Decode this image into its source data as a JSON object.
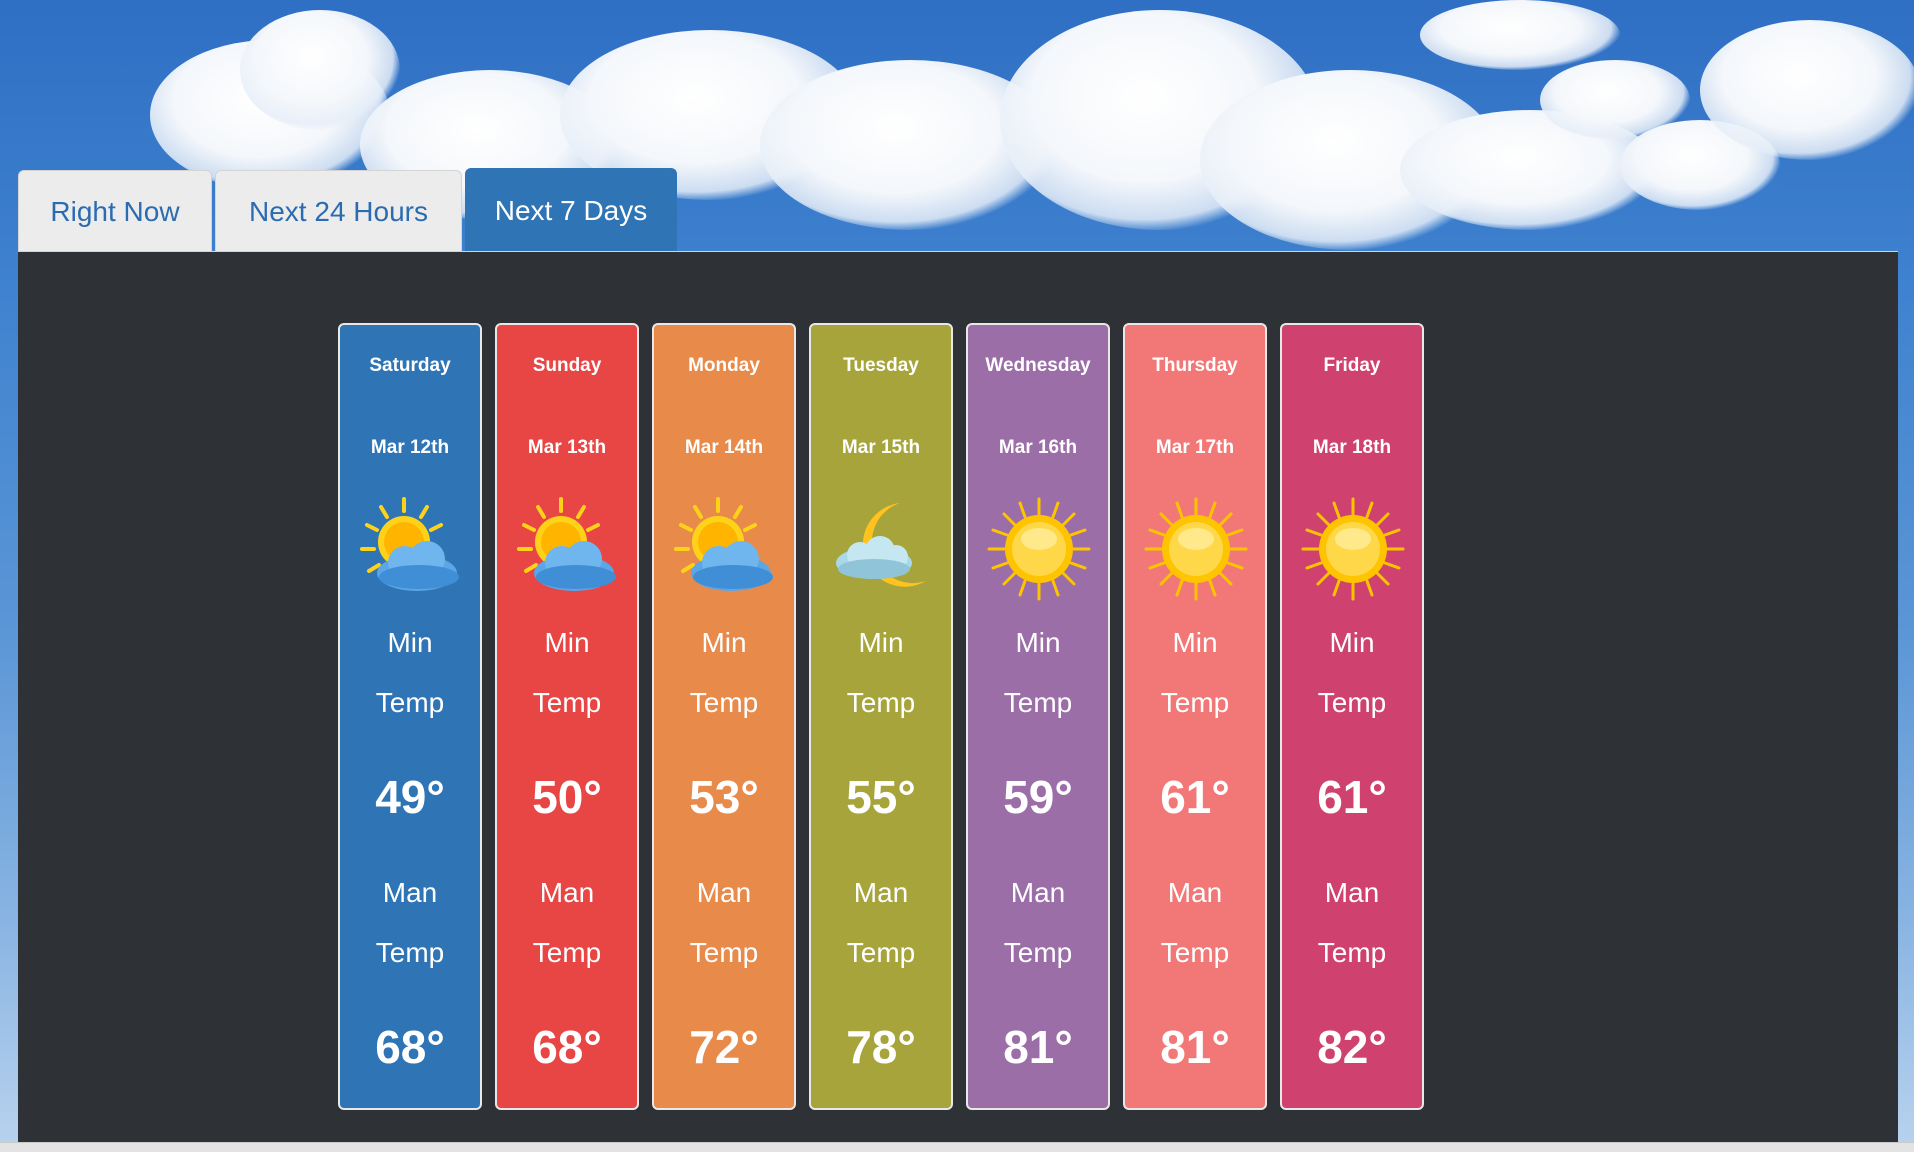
{
  "tabs": [
    {
      "label": "Right Now",
      "active": false
    },
    {
      "label": "Next 24 Hours",
      "active": false
    },
    {
      "label": "Next 7 Days",
      "active": true
    }
  ],
  "colors": {
    "tab_active": "#2f74b5",
    "tab_text": "#2b6cb0",
    "panel_bg": "#2e3135"
  },
  "days": [
    {
      "day": "Saturday",
      "date": "Mar 12th",
      "icon": "partly-cloudy-day-icon",
      "min_label_1": "Min",
      "min_label_2": "Temp",
      "min_temp": "49°",
      "max_label_1": "Man",
      "max_label_2": "Temp",
      "max_temp": "68°",
      "color": "#2f75b6"
    },
    {
      "day": "Sunday",
      "date": "Mar 13th",
      "icon": "partly-cloudy-day-icon",
      "min_label_1": "Min",
      "min_label_2": "Temp",
      "min_temp": "50°",
      "max_label_1": "Man",
      "max_label_2": "Temp",
      "max_temp": "68°",
      "color": "#e84545"
    },
    {
      "day": "Monday",
      "date": "Mar 14th",
      "icon": "partly-cloudy-day-icon",
      "min_label_1": "Min",
      "min_label_2": "Temp",
      "min_temp": "53°",
      "max_label_1": "Man",
      "max_label_2": "Temp",
      "max_temp": "72°",
      "color": "#e88a4a"
    },
    {
      "day": "Tuesday",
      "date": "Mar 15th",
      "icon": "cloudy-night-icon",
      "min_label_1": "Min",
      "min_label_2": "Temp",
      "min_temp": "55°",
      "max_label_1": "Man",
      "max_label_2": "Temp",
      "max_temp": "78°",
      "color": "#a6a43a"
    },
    {
      "day": "Wednesday",
      "date": "Mar 16th",
      "icon": "sunny-icon",
      "min_label_1": "Min",
      "min_label_2": "Temp",
      "min_temp": "59°",
      "max_label_1": "Man",
      "max_label_2": "Temp",
      "max_temp": "81°",
      "color": "#9b6ea8"
    },
    {
      "day": "Thursday",
      "date": "Mar 17th",
      "icon": "sunny-icon",
      "min_label_1": "Min",
      "min_label_2": "Temp",
      "min_temp": "61°",
      "max_label_1": "Man",
      "max_label_2": "Temp",
      "max_temp": "81°",
      "color": "#f27878"
    },
    {
      "day": "Friday",
      "date": "Mar 18th",
      "icon": "sunny-icon",
      "min_label_1": "Min",
      "min_label_2": "Temp",
      "min_temp": "61°",
      "max_label_1": "Man",
      "max_label_2": "Temp",
      "max_temp": "82°",
      "color": "#cf4270"
    }
  ]
}
